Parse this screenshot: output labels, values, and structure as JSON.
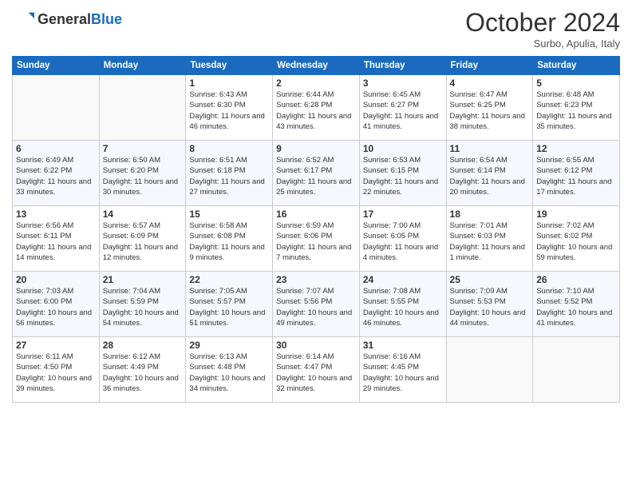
{
  "header": {
    "logo_general": "General",
    "logo_blue": "Blue",
    "month_title": "October 2024",
    "subtitle": "Surbo, Apulia, Italy"
  },
  "days_of_week": [
    "Sunday",
    "Monday",
    "Tuesday",
    "Wednesday",
    "Thursday",
    "Friday",
    "Saturday"
  ],
  "weeks": [
    [
      {
        "day": "",
        "empty": true
      },
      {
        "day": "",
        "empty": true
      },
      {
        "day": "1",
        "sunrise": "6:43 AM",
        "sunset": "6:30 PM",
        "daylight": "11 hours and 46 minutes."
      },
      {
        "day": "2",
        "sunrise": "6:44 AM",
        "sunset": "6:28 PM",
        "daylight": "11 hours and 43 minutes."
      },
      {
        "day": "3",
        "sunrise": "6:45 AM",
        "sunset": "6:27 PM",
        "daylight": "11 hours and 41 minutes."
      },
      {
        "day": "4",
        "sunrise": "6:47 AM",
        "sunset": "6:25 PM",
        "daylight": "11 hours and 38 minutes."
      },
      {
        "day": "5",
        "sunrise": "6:48 AM",
        "sunset": "6:23 PM",
        "daylight": "11 hours and 35 minutes."
      }
    ],
    [
      {
        "day": "6",
        "sunrise": "6:49 AM",
        "sunset": "6:22 PM",
        "daylight": "11 hours and 33 minutes."
      },
      {
        "day": "7",
        "sunrise": "6:50 AM",
        "sunset": "6:20 PM",
        "daylight": "11 hours and 30 minutes."
      },
      {
        "day": "8",
        "sunrise": "6:51 AM",
        "sunset": "6:18 PM",
        "daylight": "11 hours and 27 minutes."
      },
      {
        "day": "9",
        "sunrise": "6:52 AM",
        "sunset": "6:17 PM",
        "daylight": "11 hours and 25 minutes."
      },
      {
        "day": "10",
        "sunrise": "6:53 AM",
        "sunset": "6:15 PM",
        "daylight": "11 hours and 22 minutes."
      },
      {
        "day": "11",
        "sunrise": "6:54 AM",
        "sunset": "6:14 PM",
        "daylight": "11 hours and 20 minutes."
      },
      {
        "day": "12",
        "sunrise": "6:55 AM",
        "sunset": "6:12 PM",
        "daylight": "11 hours and 17 minutes."
      }
    ],
    [
      {
        "day": "13",
        "sunrise": "6:56 AM",
        "sunset": "6:11 PM",
        "daylight": "11 hours and 14 minutes."
      },
      {
        "day": "14",
        "sunrise": "6:57 AM",
        "sunset": "6:09 PM",
        "daylight": "11 hours and 12 minutes."
      },
      {
        "day": "15",
        "sunrise": "6:58 AM",
        "sunset": "6:08 PM",
        "daylight": "11 hours and 9 minutes."
      },
      {
        "day": "16",
        "sunrise": "6:59 AM",
        "sunset": "6:06 PM",
        "daylight": "11 hours and 7 minutes."
      },
      {
        "day": "17",
        "sunrise": "7:00 AM",
        "sunset": "6:05 PM",
        "daylight": "11 hours and 4 minutes."
      },
      {
        "day": "18",
        "sunrise": "7:01 AM",
        "sunset": "6:03 PM",
        "daylight": "11 hours and 1 minute."
      },
      {
        "day": "19",
        "sunrise": "7:02 AM",
        "sunset": "6:02 PM",
        "daylight": "10 hours and 59 minutes."
      }
    ],
    [
      {
        "day": "20",
        "sunrise": "7:03 AM",
        "sunset": "6:00 PM",
        "daylight": "10 hours and 56 minutes."
      },
      {
        "day": "21",
        "sunrise": "7:04 AM",
        "sunset": "5:59 PM",
        "daylight": "10 hours and 54 minutes."
      },
      {
        "day": "22",
        "sunrise": "7:05 AM",
        "sunset": "5:57 PM",
        "daylight": "10 hours and 51 minutes."
      },
      {
        "day": "23",
        "sunrise": "7:07 AM",
        "sunset": "5:56 PM",
        "daylight": "10 hours and 49 minutes."
      },
      {
        "day": "24",
        "sunrise": "7:08 AM",
        "sunset": "5:55 PM",
        "daylight": "10 hours and 46 minutes."
      },
      {
        "day": "25",
        "sunrise": "7:09 AM",
        "sunset": "5:53 PM",
        "daylight": "10 hours and 44 minutes."
      },
      {
        "day": "26",
        "sunrise": "7:10 AM",
        "sunset": "5:52 PM",
        "daylight": "10 hours and 41 minutes."
      }
    ],
    [
      {
        "day": "27",
        "sunrise": "6:11 AM",
        "sunset": "4:50 PM",
        "daylight": "10 hours and 39 minutes."
      },
      {
        "day": "28",
        "sunrise": "6:12 AM",
        "sunset": "4:49 PM",
        "daylight": "10 hours and 36 minutes."
      },
      {
        "day": "29",
        "sunrise": "6:13 AM",
        "sunset": "4:48 PM",
        "daylight": "10 hours and 34 minutes."
      },
      {
        "day": "30",
        "sunrise": "6:14 AM",
        "sunset": "4:47 PM",
        "daylight": "10 hours and 32 minutes."
      },
      {
        "day": "31",
        "sunrise": "6:16 AM",
        "sunset": "4:45 PM",
        "daylight": "10 hours and 29 minutes."
      },
      {
        "day": "",
        "empty": true
      },
      {
        "day": "",
        "empty": true
      }
    ]
  ]
}
